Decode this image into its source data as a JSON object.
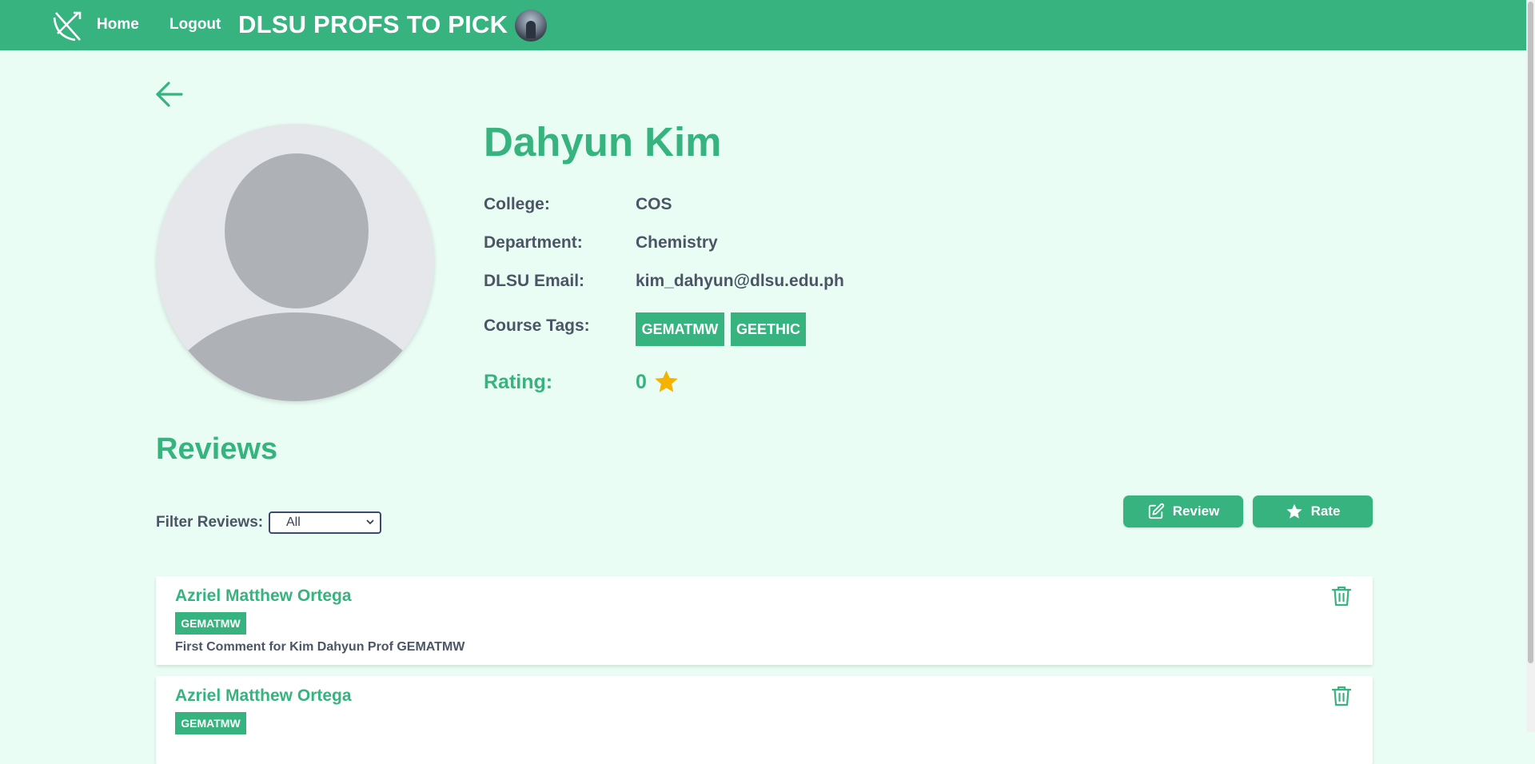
{
  "nav": {
    "logo_icon": "bow-and-arrow-logo-icon",
    "home_label": "Home",
    "logout_label": "Logout",
    "site_title": "DLSU PROFS TO PICK",
    "avatar_icon": "user-avatar-photo"
  },
  "profile": {
    "back_icon": "back-arrow-icon",
    "name": "Dahyun Kim",
    "college_label": "College:",
    "college_value": "COS",
    "department_label": "Department:",
    "department_value": "Chemistry",
    "email_label": "DLSU Email:",
    "email_value": "kim_dahyun@dlsu.edu.ph",
    "course_tags_label": "Course Tags:",
    "course_tags": [
      "GEMATMW",
      "GEETHIC"
    ],
    "rating_label": "Rating:",
    "rating_value": "0",
    "rating_icon": "star-icon"
  },
  "reviews": {
    "heading": "Reviews",
    "filter_label": "Filter Reviews:",
    "filter_selected": "All",
    "review_button_label": "Review",
    "rate_button_label": "Rate",
    "items": [
      {
        "author": "Azriel Matthew Ortega",
        "tag": "GEMATMW",
        "text": "First Comment for Kim Dahyun Prof GEMATMW"
      },
      {
        "author": "Azriel Matthew Ortega",
        "tag": "GEMATMW",
        "text": ""
      }
    ]
  },
  "colors": {
    "primary": "#36b37e",
    "background": "#eafdf4",
    "text_dark": "#4b5566",
    "star": "#f5b301"
  }
}
